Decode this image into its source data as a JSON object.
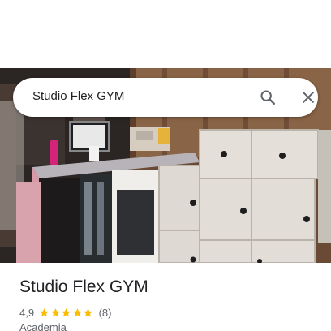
{
  "search": {
    "query": "Studio Flex GYM",
    "search_icon": "search-icon",
    "close_icon": "close-icon"
  },
  "place": {
    "name": "Studio Flex GYM",
    "rating": "4,9",
    "stars_filled": 5,
    "stars_total": 5,
    "review_count": "(8)",
    "category": "Academia"
  },
  "colors": {
    "star": "#fbbc04",
    "icon": "#5f6368",
    "text_primary": "#202124",
    "text_secondary": "#5f6368"
  }
}
